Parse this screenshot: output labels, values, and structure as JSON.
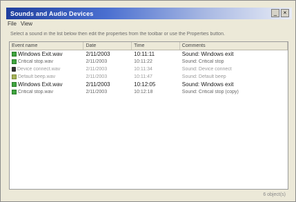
{
  "window": {
    "title": "Sounds and Audio Devices",
    "controls": {
      "minimize": "_",
      "close": "×"
    }
  },
  "menu": [
    {
      "label": "File"
    },
    {
      "label": "View"
    }
  ],
  "instruction": "Select a sound in the list below then edit the properties from the toolbar or use the Properties button.",
  "list": {
    "columns": [
      "Event name",
      "Date",
      "Time",
      "Comments"
    ],
    "rows": [
      {
        "icon": "green-square-icon",
        "name": "Windows Exit.wav",
        "date": "2/11/2003",
        "time": "10:11:11",
        "comment": "Sound: Windows exit",
        "style": "bold"
      },
      {
        "icon": "green-square-icon",
        "name": "Critical stop.wav",
        "date": "2/11/2003",
        "time": "10:11:22",
        "comment": "Sound: Critical stop",
        "style": "normal"
      },
      {
        "icon": "speaker-icon",
        "name": "Device connect.wav",
        "date": "2/11/2003",
        "time": "10:11:34",
        "comment": "Sound: Device connect",
        "style": "faint"
      },
      {
        "icon": "olive-square-icon",
        "name": "Default beep.wav",
        "date": "2/11/2003",
        "time": "10:11:47",
        "comment": "Sound: Default beep",
        "style": "faint"
      },
      {
        "icon": "green-square-icon",
        "name": "Windows Exit.wav",
        "date": "2/11/2003",
        "time": "10:12:05",
        "comment": "Sound: Windows exit",
        "style": "bold"
      },
      {
        "icon": "green-square-icon",
        "name": "Critical stop.wav",
        "date": "2/11/2003",
        "time": "10:12:18",
        "comment": "Sound: Critical stop (copy)",
        "style": "normal"
      }
    ]
  },
  "status": "6 object(s)"
}
